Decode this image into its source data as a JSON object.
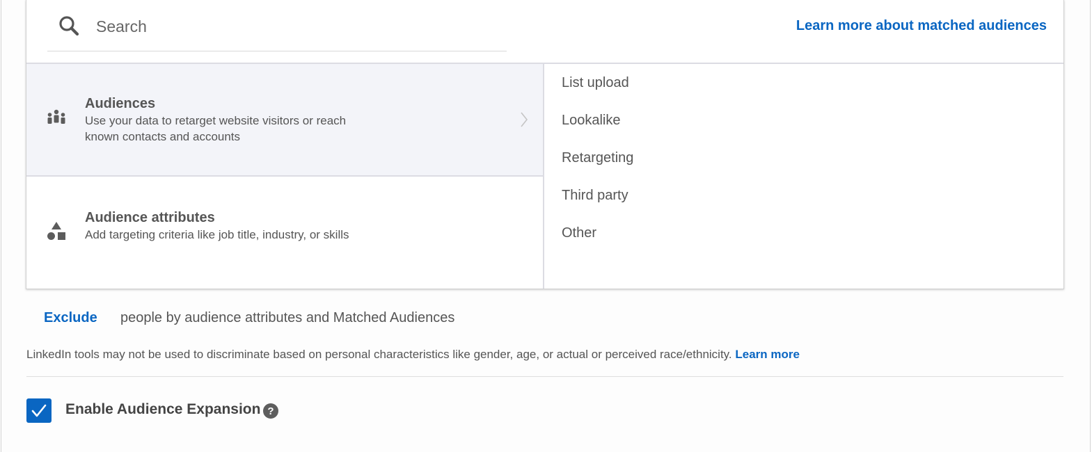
{
  "search": {
    "placeholder": "Search",
    "learn_more_label": "Learn more about matched audiences"
  },
  "categories": [
    {
      "title": "Audiences",
      "description": "Use your data to retarget website visitors or reach known contacts and accounts",
      "icon": "people-group-icon",
      "selected": true
    },
    {
      "title": "Audience attributes",
      "description": "Add targeting criteria like job title, industry, or skills",
      "icon": "shapes-icon",
      "selected": false
    }
  ],
  "subcategories": [
    "List upload",
    "Lookalike",
    "Retargeting",
    "Third party",
    "Other"
  ],
  "exclude": {
    "link_label": "Exclude",
    "text": "people by audience attributes and Matched Audiences"
  },
  "disclaimer": {
    "text": "LinkedIn tools may not be used to discriminate based on personal characteristics like gender, age, or actual or perceived race/ethnicity.",
    "link_label": "Learn more"
  },
  "expansion": {
    "label": "Enable Audience Expansion",
    "checked": true,
    "help_icon": "help-icon"
  },
  "colors": {
    "accent": "#0a66c2",
    "selected_bg": "#f3f4f9",
    "text": "#555555"
  }
}
